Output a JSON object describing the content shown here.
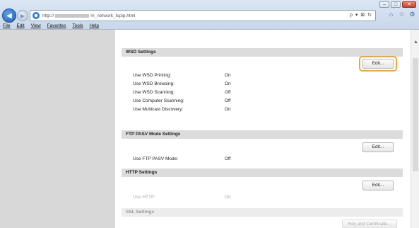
{
  "window": {
    "minimize": "–",
    "maximize": "□",
    "close": "✕"
  },
  "address": {
    "scheme": "http://",
    "path": "m_network_tcpip.html",
    "tools": "ρ ▾ ⊠ ↻"
  },
  "menu": [
    "File",
    "Edit",
    "View",
    "Favorites",
    "Tools",
    "Help"
  ],
  "sections": {
    "wsd": {
      "title": "WSD Settings",
      "edit": "Edit...",
      "rows": [
        {
          "label": "Use WSD Printing:",
          "value": "On"
        },
        {
          "label": "Use WSD Browsing:",
          "value": "On"
        },
        {
          "label": "Use WSD Scanning:",
          "value": "Off"
        },
        {
          "label": "Use Computer Scanning:",
          "value": "Off"
        },
        {
          "label": "Use Multicast Discovery:",
          "value": "On"
        }
      ]
    },
    "ftp": {
      "title": "FTP PASV Mode Settings",
      "edit": "Edit...",
      "rows": [
        {
          "label": "Use FTP PASV Mode:",
          "value": "Off"
        }
      ]
    },
    "http": {
      "title": "HTTP Settings",
      "edit": "Edit...",
      "rows": [
        {
          "label": "Use HTTP:",
          "value": "On"
        }
      ]
    },
    "ssl": {
      "title": "SSL Settings",
      "button": "Key and Certificate..."
    }
  },
  "colors": {
    "highlight": "#f0a830",
    "section_bg": "#dcdcdc",
    "left_pane": "#d8d8d8"
  }
}
